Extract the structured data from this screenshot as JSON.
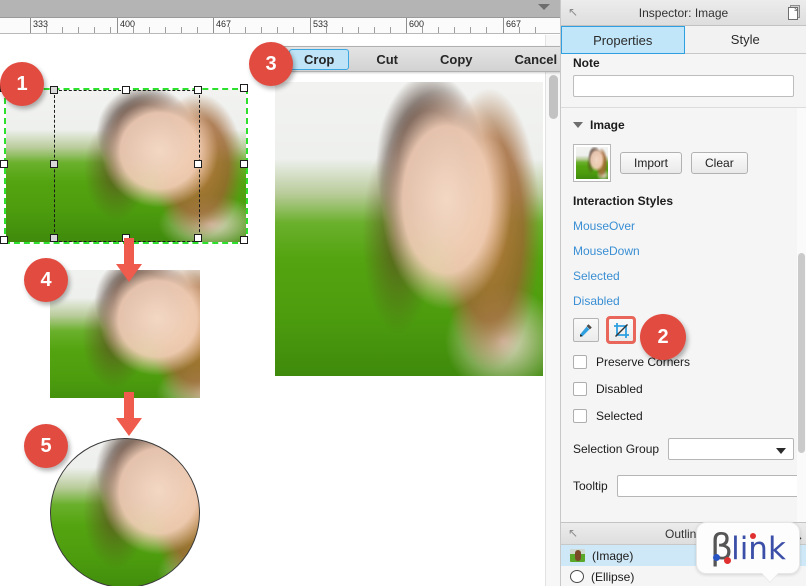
{
  "canvas": {
    "ruler": {
      "labels": [
        "333",
        "400",
        "467",
        "533",
        "600",
        "667"
      ],
      "positions": [
        30,
        117,
        213,
        310,
        406,
        503
      ],
      "unit": "px"
    },
    "crop_toolbar": {
      "buttons": [
        {
          "label": "Crop",
          "active": true
        },
        {
          "label": "Cut",
          "active": false
        },
        {
          "label": "Copy",
          "active": false
        },
        {
          "label": "Cancel",
          "active": false
        }
      ]
    },
    "step_badges": [
      {
        "number": "1"
      },
      {
        "number": "2"
      },
      {
        "number": "3"
      },
      {
        "number": "4"
      },
      {
        "number": "5"
      }
    ],
    "chevron_icon": "chevron-down-icon"
  },
  "inspector": {
    "header": {
      "title": "Inspector: Image",
      "collapse_icon": "collapse-arrow-icon",
      "doc_icon": "document-icon"
    },
    "tabs": [
      {
        "label": "Properties",
        "active": true
      },
      {
        "label": "Style",
        "active": false
      }
    ],
    "note": {
      "label": "Note",
      "value": "",
      "placeholder": ""
    },
    "image_section": {
      "title": "Image",
      "import_label": "Import",
      "clear_label": "Clear",
      "thumbnail_icon": "image-thumbnail"
    },
    "interaction_styles": {
      "title": "Interaction Styles",
      "links": [
        "MouseOver",
        "MouseDown",
        "Selected",
        "Disabled"
      ],
      "tool_buttons": [
        {
          "icon": "eyedropper-icon",
          "highlighted": false
        },
        {
          "icon": "crop-tool-icon",
          "highlighted": true
        }
      ]
    },
    "checkboxes": [
      {
        "label": "Preserve Corners",
        "checked": false
      },
      {
        "label": "Disabled",
        "checked": false
      },
      {
        "label": "Selected",
        "checked": false
      }
    ],
    "selection_group": {
      "label": "Selection Group",
      "value": "",
      "caret_icon": "chevron-down-icon"
    },
    "tooltip": {
      "label": "Tooltip",
      "value": "",
      "placeholder": ""
    }
  },
  "outline": {
    "header": {
      "title": "Outline",
      "collapse_icon": "collapse-arrow-icon",
      "search_icon": "search-icon"
    },
    "items": [
      {
        "label": "(Image)",
        "icon": "image-thumbnail-icon",
        "selected": true
      },
      {
        "label": "(Ellipse)",
        "icon": "ellipse-icon",
        "selected": false
      }
    ]
  },
  "watermark": {
    "text_beta": "β",
    "text_rest": "link",
    "full": "Blink"
  },
  "colors": {
    "accent_blue": "#3a8fd4",
    "badge_red": "#e24b40",
    "selection_green": "#2ee02e",
    "tab_active": "#c2e6f9",
    "arrow_red": "#ef5b4c"
  }
}
